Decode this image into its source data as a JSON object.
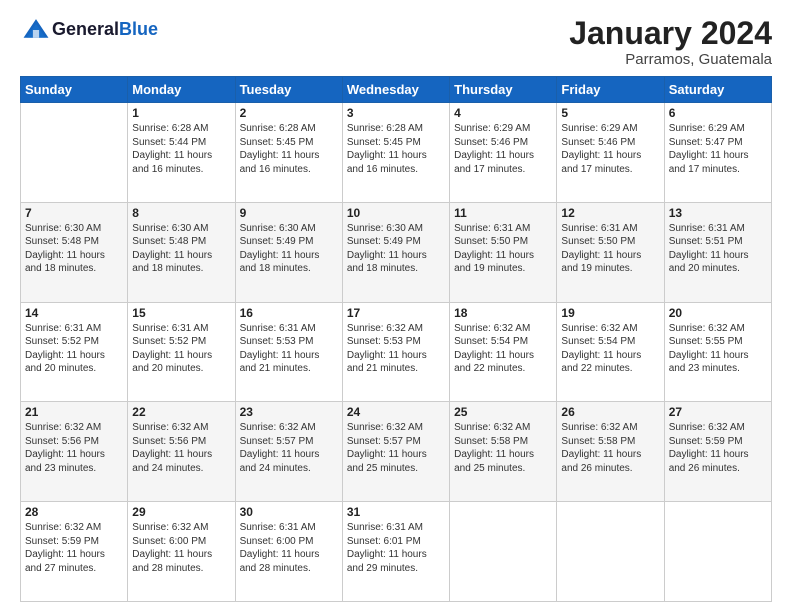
{
  "logo": {
    "general": "General",
    "blue": "Blue"
  },
  "header": {
    "month": "January 2024",
    "location": "Parramos, Guatemala"
  },
  "weekdays": [
    "Sunday",
    "Monday",
    "Tuesday",
    "Wednesday",
    "Thursday",
    "Friday",
    "Saturday"
  ],
  "weeks": [
    [
      {
        "day": "",
        "info": ""
      },
      {
        "day": "1",
        "info": "Sunrise: 6:28 AM\nSunset: 5:44 PM\nDaylight: 11 hours\nand 16 minutes."
      },
      {
        "day": "2",
        "info": "Sunrise: 6:28 AM\nSunset: 5:45 PM\nDaylight: 11 hours\nand 16 minutes."
      },
      {
        "day": "3",
        "info": "Sunrise: 6:28 AM\nSunset: 5:45 PM\nDaylight: 11 hours\nand 16 minutes."
      },
      {
        "day": "4",
        "info": "Sunrise: 6:29 AM\nSunset: 5:46 PM\nDaylight: 11 hours\nand 17 minutes."
      },
      {
        "day": "5",
        "info": "Sunrise: 6:29 AM\nSunset: 5:46 PM\nDaylight: 11 hours\nand 17 minutes."
      },
      {
        "day": "6",
        "info": "Sunrise: 6:29 AM\nSunset: 5:47 PM\nDaylight: 11 hours\nand 17 minutes."
      }
    ],
    [
      {
        "day": "7",
        "info": "Sunrise: 6:30 AM\nSunset: 5:48 PM\nDaylight: 11 hours\nand 18 minutes."
      },
      {
        "day": "8",
        "info": "Sunrise: 6:30 AM\nSunset: 5:48 PM\nDaylight: 11 hours\nand 18 minutes."
      },
      {
        "day": "9",
        "info": "Sunrise: 6:30 AM\nSunset: 5:49 PM\nDaylight: 11 hours\nand 18 minutes."
      },
      {
        "day": "10",
        "info": "Sunrise: 6:30 AM\nSunset: 5:49 PM\nDaylight: 11 hours\nand 18 minutes."
      },
      {
        "day": "11",
        "info": "Sunrise: 6:31 AM\nSunset: 5:50 PM\nDaylight: 11 hours\nand 19 minutes."
      },
      {
        "day": "12",
        "info": "Sunrise: 6:31 AM\nSunset: 5:50 PM\nDaylight: 11 hours\nand 19 minutes."
      },
      {
        "day": "13",
        "info": "Sunrise: 6:31 AM\nSunset: 5:51 PM\nDaylight: 11 hours\nand 20 minutes."
      }
    ],
    [
      {
        "day": "14",
        "info": "Sunrise: 6:31 AM\nSunset: 5:52 PM\nDaylight: 11 hours\nand 20 minutes."
      },
      {
        "day": "15",
        "info": "Sunrise: 6:31 AM\nSunset: 5:52 PM\nDaylight: 11 hours\nand 20 minutes."
      },
      {
        "day": "16",
        "info": "Sunrise: 6:31 AM\nSunset: 5:53 PM\nDaylight: 11 hours\nand 21 minutes."
      },
      {
        "day": "17",
        "info": "Sunrise: 6:32 AM\nSunset: 5:53 PM\nDaylight: 11 hours\nand 21 minutes."
      },
      {
        "day": "18",
        "info": "Sunrise: 6:32 AM\nSunset: 5:54 PM\nDaylight: 11 hours\nand 22 minutes."
      },
      {
        "day": "19",
        "info": "Sunrise: 6:32 AM\nSunset: 5:54 PM\nDaylight: 11 hours\nand 22 minutes."
      },
      {
        "day": "20",
        "info": "Sunrise: 6:32 AM\nSunset: 5:55 PM\nDaylight: 11 hours\nand 23 minutes."
      }
    ],
    [
      {
        "day": "21",
        "info": "Sunrise: 6:32 AM\nSunset: 5:56 PM\nDaylight: 11 hours\nand 23 minutes."
      },
      {
        "day": "22",
        "info": "Sunrise: 6:32 AM\nSunset: 5:56 PM\nDaylight: 11 hours\nand 24 minutes."
      },
      {
        "day": "23",
        "info": "Sunrise: 6:32 AM\nSunset: 5:57 PM\nDaylight: 11 hours\nand 24 minutes."
      },
      {
        "day": "24",
        "info": "Sunrise: 6:32 AM\nSunset: 5:57 PM\nDaylight: 11 hours\nand 25 minutes."
      },
      {
        "day": "25",
        "info": "Sunrise: 6:32 AM\nSunset: 5:58 PM\nDaylight: 11 hours\nand 25 minutes."
      },
      {
        "day": "26",
        "info": "Sunrise: 6:32 AM\nSunset: 5:58 PM\nDaylight: 11 hours\nand 26 minutes."
      },
      {
        "day": "27",
        "info": "Sunrise: 6:32 AM\nSunset: 5:59 PM\nDaylight: 11 hours\nand 26 minutes."
      }
    ],
    [
      {
        "day": "28",
        "info": "Sunrise: 6:32 AM\nSunset: 5:59 PM\nDaylight: 11 hours\nand 27 minutes."
      },
      {
        "day": "29",
        "info": "Sunrise: 6:32 AM\nSunset: 6:00 PM\nDaylight: 11 hours\nand 28 minutes."
      },
      {
        "day": "30",
        "info": "Sunrise: 6:31 AM\nSunset: 6:00 PM\nDaylight: 11 hours\nand 28 minutes."
      },
      {
        "day": "31",
        "info": "Sunrise: 6:31 AM\nSunset: 6:01 PM\nDaylight: 11 hours\nand 29 minutes."
      },
      {
        "day": "",
        "info": ""
      },
      {
        "day": "",
        "info": ""
      },
      {
        "day": "",
        "info": ""
      }
    ]
  ]
}
